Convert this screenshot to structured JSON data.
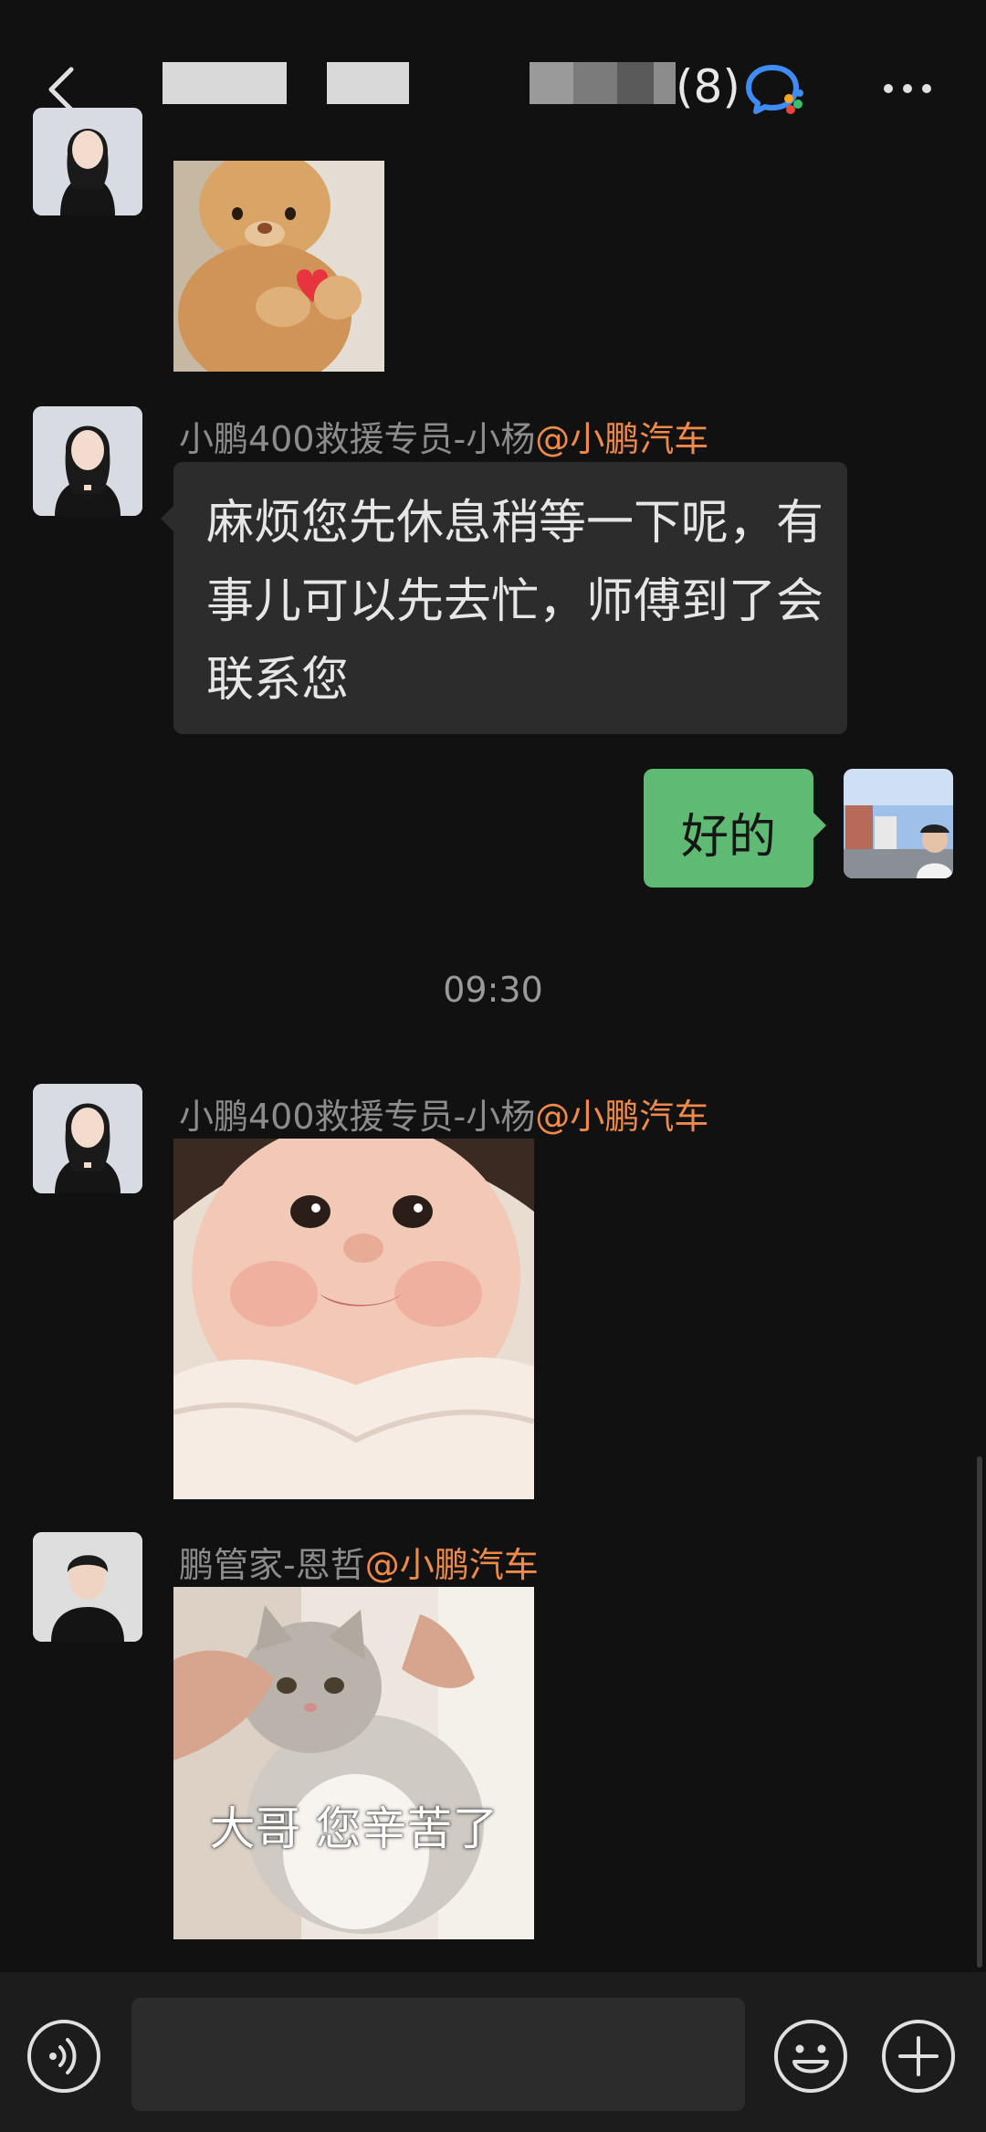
{
  "header": {
    "member_count": "(8)",
    "icons": {
      "back": "back-arrow-icon",
      "chat_app": "wecom-chat-icon",
      "more": "more-dots-icon"
    }
  },
  "messages": [
    {
      "type": "image",
      "sender_side": "left",
      "image": "teddy-bear-heart-sticker"
    },
    {
      "type": "text",
      "sender_side": "left",
      "sender": "小鹏400救援专员-小杨",
      "org": "@小鹏汽车",
      "text": "麻烦您先休息稍等一下呢，有事儿可以先去忙，师傅到了会联系您"
    },
    {
      "type": "text",
      "sender_side": "right",
      "text": "好的"
    },
    {
      "type": "time",
      "text": "09:30"
    },
    {
      "type": "image",
      "sender_side": "left",
      "sender": "小鹏400救援专员-小杨",
      "org": "@小鹏汽车",
      "image": "baby-face-sticker"
    },
    {
      "type": "image",
      "sender_side": "left",
      "sender": "鹏管家-恩哲",
      "org": "@小鹏汽车",
      "image": "cat-sticker",
      "caption": "大哥 您辛苦了"
    }
  ],
  "input": {
    "placeholder": ""
  },
  "bottom_icons": {
    "voice": "voice-icon",
    "emoji": "emoji-icon",
    "plus": "plus-icon"
  },
  "colors": {
    "background": "#111111",
    "bubble_in": "#2c2c2c",
    "bubble_out": "#5fbb73",
    "org_tag": "#f08a4b"
  }
}
